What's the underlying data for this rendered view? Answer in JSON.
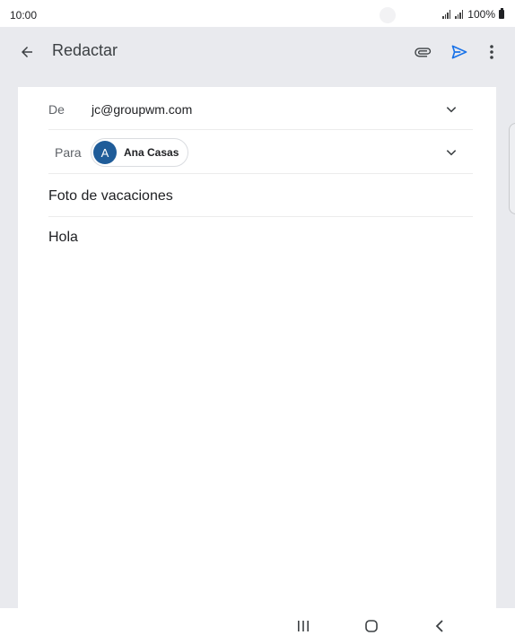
{
  "status_bar": {
    "time": "10:00",
    "battery": "100%"
  },
  "app_bar": {
    "title": "Redactar",
    "icons": {
      "back": "arrow-back-icon",
      "attach": "paperclip-icon",
      "send": "send-icon",
      "more": "more-vert-icon"
    }
  },
  "compose": {
    "from_label": "De",
    "from_value": "jc@groupwm.com",
    "to_label": "Para",
    "recipient": {
      "initial": "A",
      "name": "Ana Casas"
    },
    "subject": "Foto de vacaciones",
    "body": "Hola"
  },
  "nav_bar": {
    "icons": [
      "recent-apps-icon",
      "home-icon",
      "back-icon"
    ]
  },
  "colors": {
    "accent": "#1a73e8",
    "avatar": "#1f5c99",
    "background": "#e9eaee"
  }
}
